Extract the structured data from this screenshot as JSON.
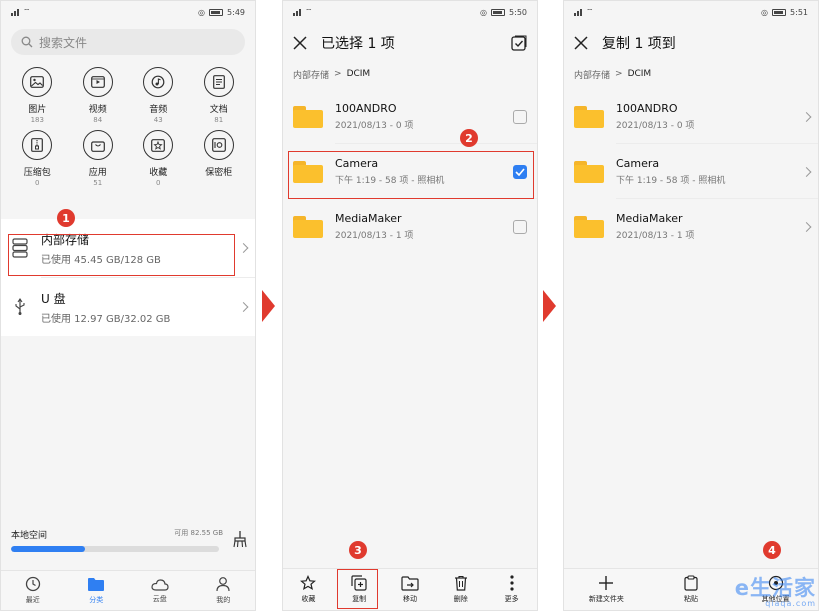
{
  "colors": {
    "accent": "#2f7ff2",
    "annotation": "#e03a2e",
    "folder": "#fbc02d"
  },
  "screen1": {
    "status": {
      "left": "⁴ᴳ ᵢₗ ⌔ ▣",
      "time": "5:49"
    },
    "search_placeholder": "搜索文件",
    "categories": [
      {
        "label": "图片",
        "count": "183",
        "icon": "image-icon"
      },
      {
        "label": "视频",
        "count": "84",
        "icon": "video-icon"
      },
      {
        "label": "音频",
        "count": "43",
        "icon": "music-icon"
      },
      {
        "label": "文档",
        "count": "81",
        "icon": "document-icon"
      },
      {
        "label": "压缩包",
        "count": "0",
        "icon": "archive-icon"
      },
      {
        "label": "应用",
        "count": "51",
        "icon": "app-bag-icon"
      },
      {
        "label": "收藏",
        "count": "0",
        "icon": "favorite-icon"
      },
      {
        "label": "保密柜",
        "count": "",
        "icon": "safe-icon"
      }
    ],
    "storage": [
      {
        "name": "内部存储",
        "usage": "已使用 45.45 GB/128 GB",
        "icon": "internal-storage-icon"
      },
      {
        "name": "U 盘",
        "usage": "已使用 12.97 GB/32.02 GB",
        "icon": "usb-icon"
      }
    ],
    "local": {
      "label": "本地空间",
      "available": "可用 82.55 GB",
      "used_fraction": 0.355
    },
    "tabs": [
      {
        "label": "最近",
        "icon": "clock-icon"
      },
      {
        "label": "分类",
        "icon": "folder-icon"
      },
      {
        "label": "云盘",
        "icon": "cloud-icon"
      },
      {
        "label": "我的",
        "icon": "person-icon"
      }
    ],
    "badge": "1"
  },
  "screen2": {
    "status": {
      "left": "⁴ᴳ ᵢₗ ⌔ ▣",
      "time": "5:50"
    },
    "title": "已选择 1 项",
    "breadcrumb": [
      "内部存储",
      "DCIM"
    ],
    "folders": [
      {
        "name": "100ANDRO",
        "meta": "2021/08/13 - 0 项",
        "checked": false
      },
      {
        "name": "Camera",
        "meta": "下午 1:19 - 58 项 - 照相机",
        "checked": true
      },
      {
        "name": "MediaMaker",
        "meta": "2021/08/13 - 1 项",
        "checked": false
      }
    ],
    "toolbar": [
      {
        "label": "收藏",
        "icon": "star-icon"
      },
      {
        "label": "复制",
        "icon": "copy-icon"
      },
      {
        "label": "移动",
        "icon": "move-icon"
      },
      {
        "label": "删除",
        "icon": "trash-icon"
      },
      {
        "label": "更多",
        "icon": "more-icon"
      }
    ],
    "badge_folder": "2",
    "badge_copy": "3"
  },
  "screen3": {
    "status": {
      "left": "⁴ᴳ ᵢₗ ⌔ ▣",
      "time": "5:51"
    },
    "title": "复制 1 项到",
    "breadcrumb": [
      "内部存储",
      "DCIM"
    ],
    "folders": [
      {
        "name": "100ANDRO",
        "meta": "2021/08/13 - 0 项"
      },
      {
        "name": "Camera",
        "meta": "下午 1:19 - 58 项 - 照相机"
      },
      {
        "name": "MediaMaker",
        "meta": "2021/08/13 - 1 项"
      }
    ],
    "toolbar": [
      {
        "label": "新建文件夹",
        "icon": "plus-icon"
      },
      {
        "label": "粘贴",
        "icon": "paste-icon"
      },
      {
        "label": "其他位置",
        "icon": "location-icon"
      }
    ],
    "badge": "4",
    "watermark": {
      "big": "e生活家",
      "small": "qiaqa.com"
    }
  }
}
